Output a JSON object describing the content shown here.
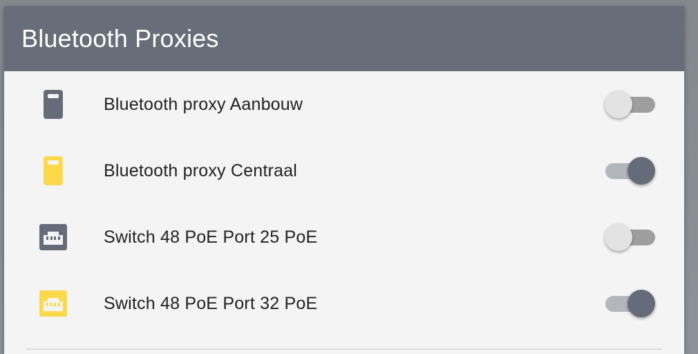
{
  "card": {
    "title": "Bluetooth Proxies"
  },
  "rows": [
    {
      "label": "Bluetooth proxy Aanbouw",
      "icon": "bluetooth-proxy-device-icon",
      "icon_color": "#656b78",
      "toggle_on": false
    },
    {
      "label": "Bluetooth proxy Centraal",
      "icon": "bluetooth-proxy-device-icon",
      "icon_color": "#fbd94b",
      "toggle_on": true
    },
    {
      "label": "Switch 48 PoE Port 25 PoE",
      "icon": "ethernet-port-icon",
      "icon_color": "#656b78",
      "toggle_on": false
    },
    {
      "label": "Switch 48 PoE Port 32 PoE",
      "icon": "ethernet-port-icon",
      "icon_color": "#fbd94b",
      "toggle_on": true
    }
  ],
  "colors": {
    "header_bg": "#676e79",
    "card_bg": "#f4f4f4",
    "toggle_on_thumb": "#656b78",
    "toggle_off_thumb": "#e3e3e3",
    "accent_yellow": "#fbd94b"
  }
}
